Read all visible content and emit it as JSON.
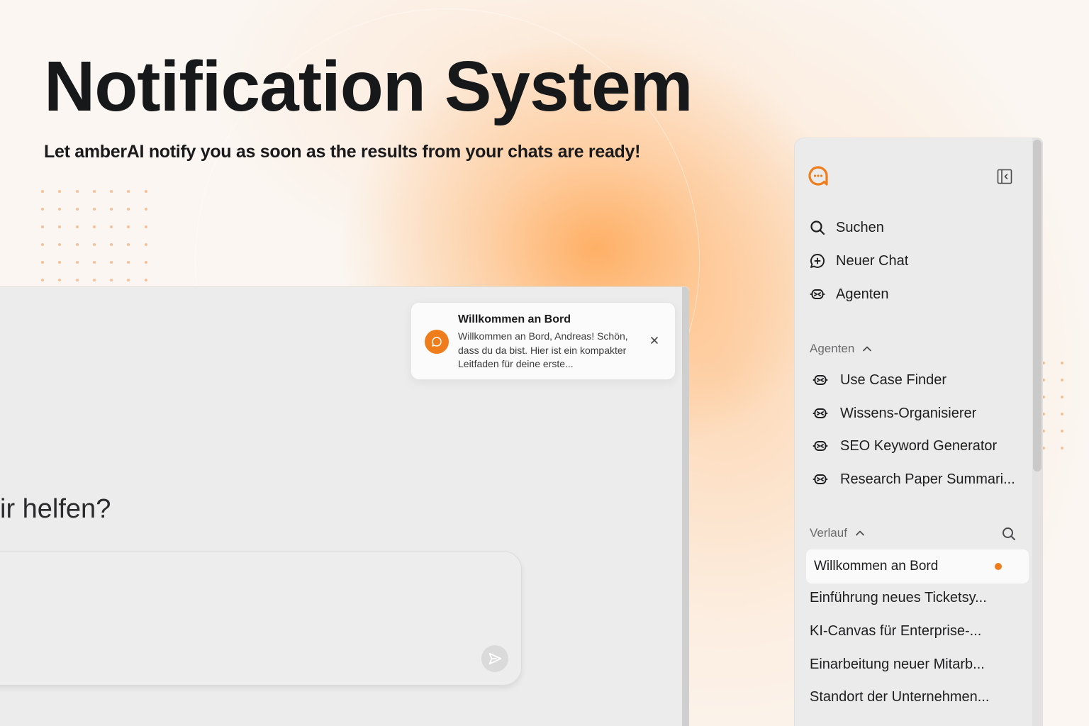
{
  "hero": {
    "title": "Notification System",
    "subtitle": "Let amberAI notify you as soon as the results from your chats are ready!"
  },
  "chat": {
    "greeting_partial": "ir helfen?",
    "send_icon": "send-icon"
  },
  "notification": {
    "icon": "chat-bubble-icon",
    "title": "Willkommen an Bord",
    "body": "Willkommen an Bord, Andreas! Schön, dass du da bist. Hier ist ein kompakter Leitfaden für deine erste...",
    "close_icon": "close-icon"
  },
  "sidebar": {
    "logo": "amberai-logo",
    "collapse_icon": "sidebar-collapse-icon",
    "nav": [
      {
        "label": "Suchen",
        "icon": "search-icon"
      },
      {
        "label": "Neuer Chat",
        "icon": "new-chat-icon"
      },
      {
        "label": "Agenten",
        "icon": "agent-icon"
      }
    ],
    "agents_section": {
      "label": "Agenten",
      "items": [
        "Use Case Finder",
        "Wissens-Organisierer",
        "SEO Keyword Generator",
        "Research Paper Summari..."
      ]
    },
    "history_section": {
      "label": "Verlauf",
      "items": [
        {
          "label": "Willkommen an Bord",
          "unread": true
        },
        {
          "label": "Einführung neues Ticketsy...",
          "unread": false
        },
        {
          "label": "KI-Canvas für Enterprise-...",
          "unread": false
        },
        {
          "label": "Einarbeitung neuer Mitarb...",
          "unread": false
        },
        {
          "label": "Standort der Unternehmen...",
          "unread": false
        }
      ]
    }
  },
  "colors": {
    "accent": "#f07d1c",
    "sidebar_bg": "#ebebeb",
    "window_bg": "#ececec"
  }
}
